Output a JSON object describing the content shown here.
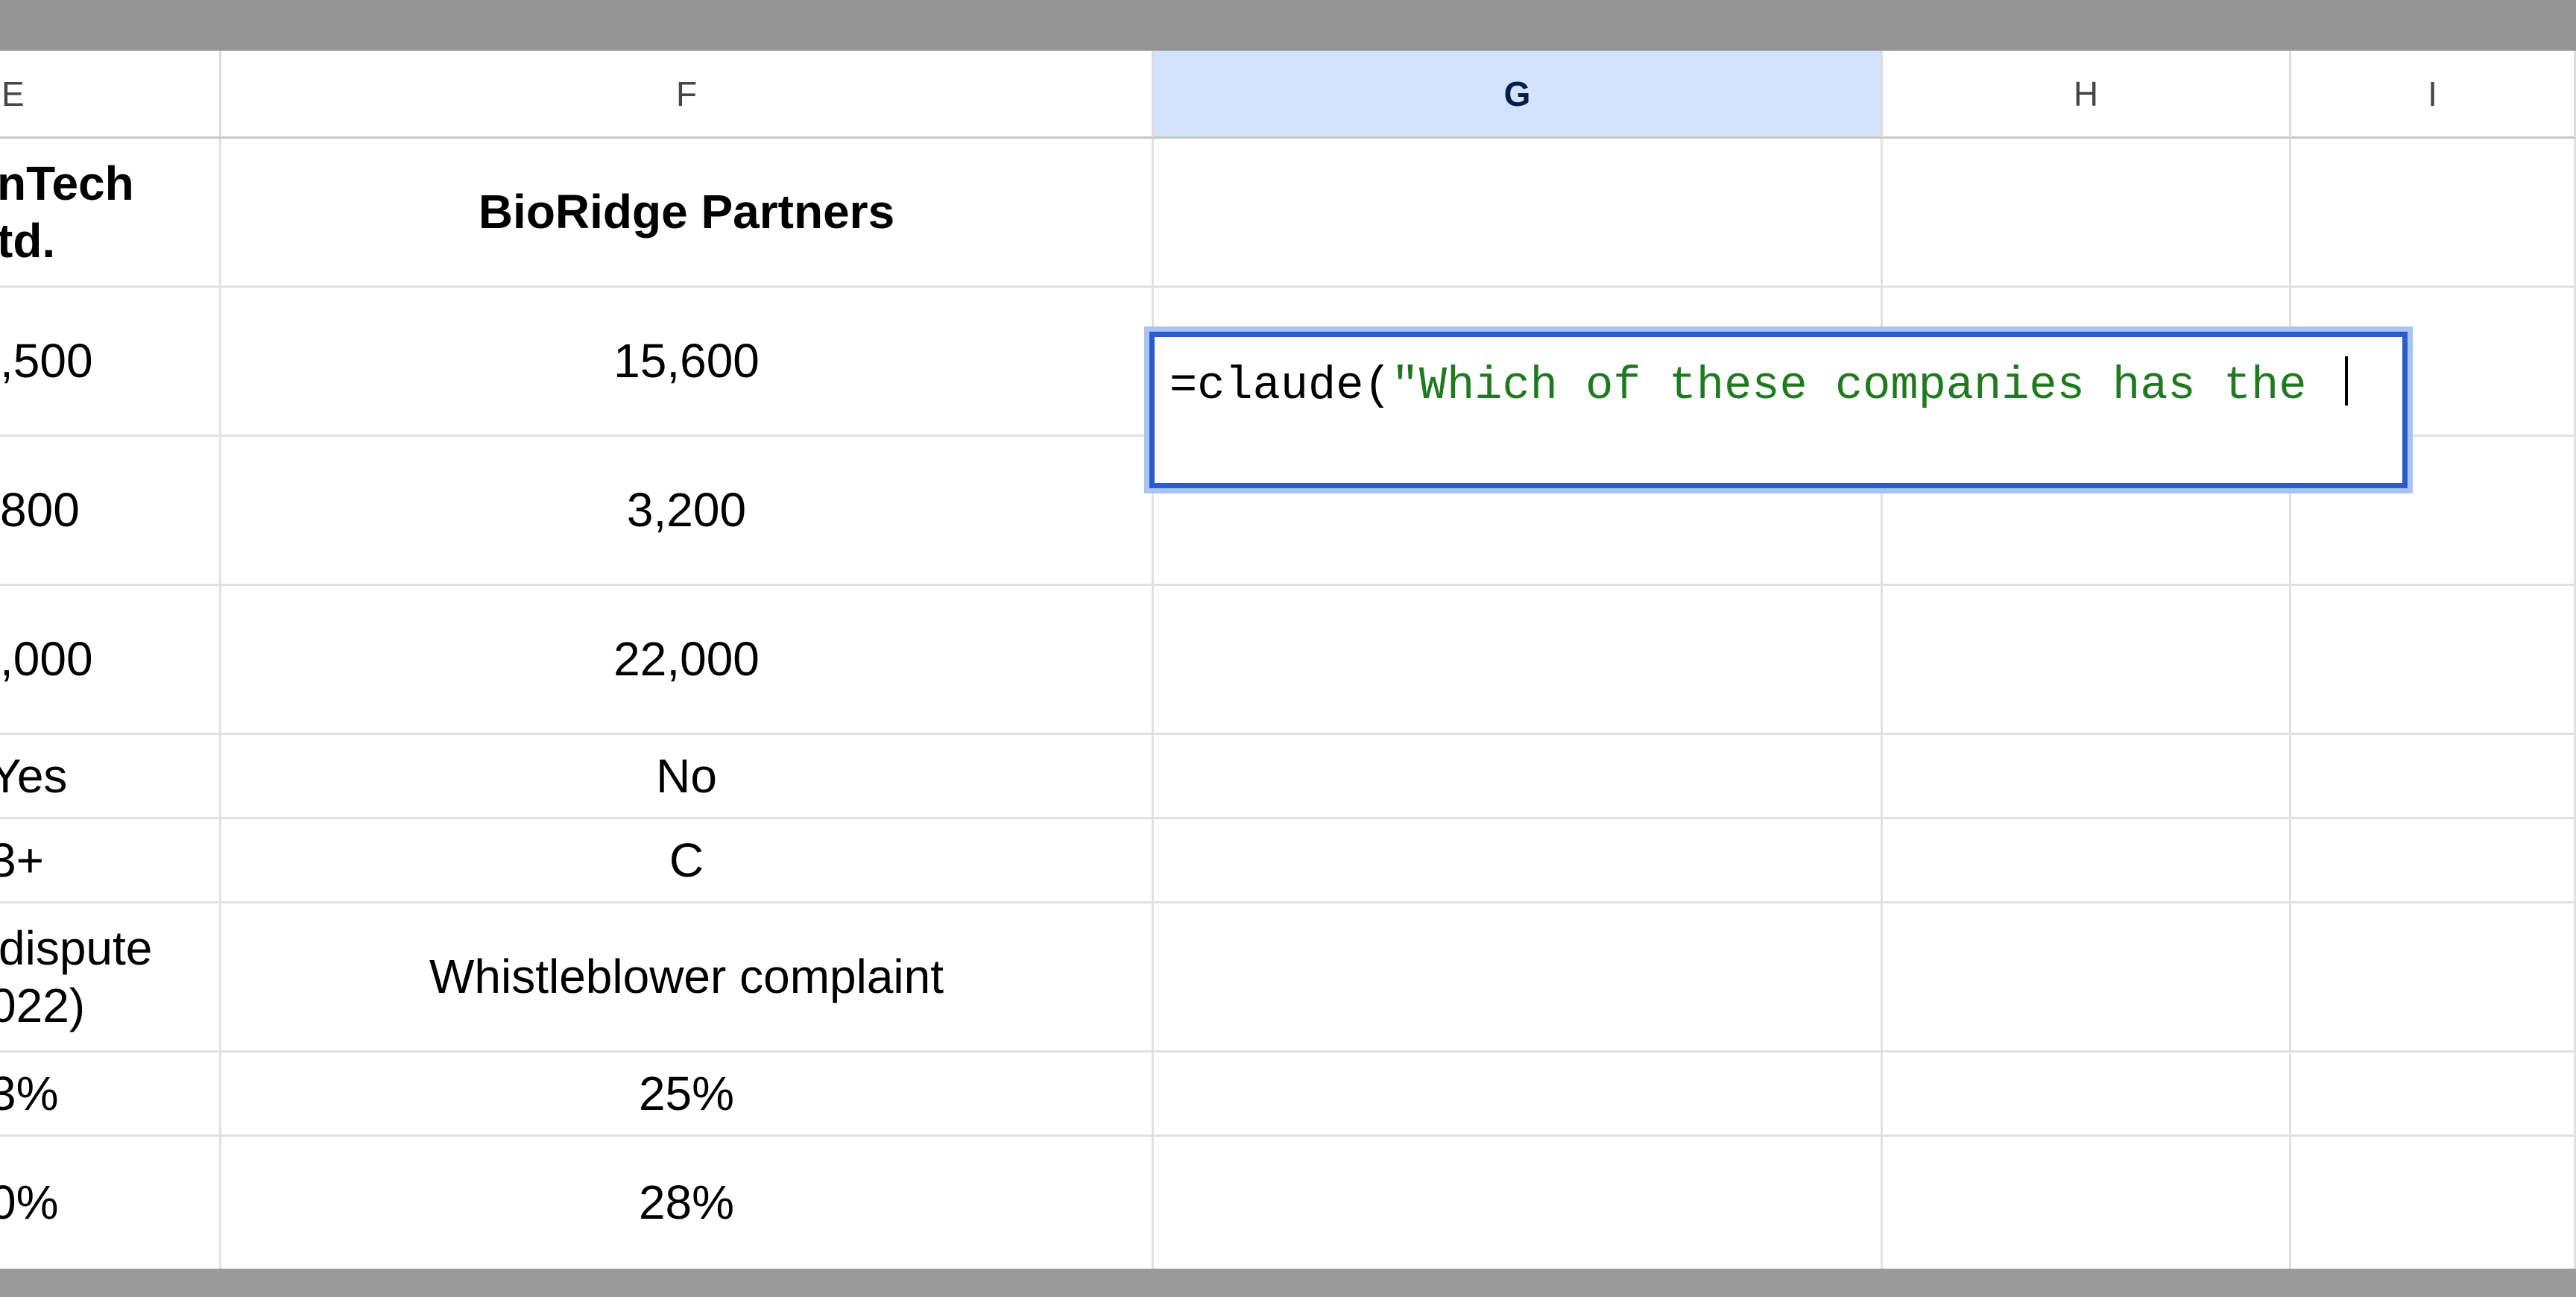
{
  "columns": [
    "E",
    "F",
    "G",
    "H",
    "I"
  ],
  "selected_column": "G",
  "rows": {
    "header": {
      "e_line1": "nTech",
      "e_line2": "td.",
      "f": "BioRidge Partners"
    },
    "r1": {
      "e": ",500",
      "f": "15,600"
    },
    "r2": {
      "e": "800",
      "f": "3,200"
    },
    "r3": {
      "e": ",000",
      "f": "22,000"
    },
    "r4": {
      "e": "Yes",
      "f": "No"
    },
    "r5": {
      "e": "3+",
      "f": "C"
    },
    "r6": {
      "e_line1": "dispute",
      "e_line2": "022)",
      "f": "Whistleblower complaint"
    },
    "r7": {
      "e": "3%",
      "f": "25%"
    },
    "r8": {
      "e": "0%",
      "f": "28%"
    }
  },
  "editor": {
    "function_part": "=claude(",
    "string_part": "\"Which of these companies has the "
  },
  "colors": {
    "selected_header_bg": "#d3e3fd",
    "editor_border": "#2b5ccc",
    "string_color": "#1e7a1e"
  }
}
